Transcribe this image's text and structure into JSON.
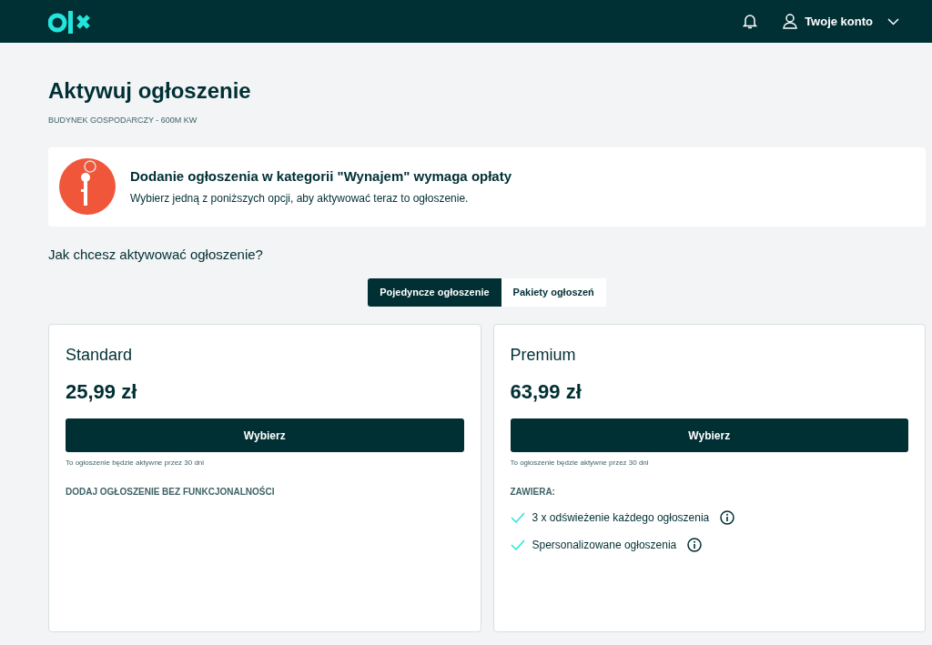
{
  "header": {
    "account_label": "Twoje konto"
  },
  "page": {
    "title": "Aktywuj ogłoszenie",
    "subtitle": "BUDYNEK GOSPODARCZY - 600M KW"
  },
  "notice": {
    "title": "Dodanie ogłoszenia w kategorii \"Wynajem\" wymaga opłaty",
    "text": "Wybierz jedną z poniższych opcji, aby aktywować teraz to ogłoszenie."
  },
  "question": "Jak chcesz aktywować ogłoszenie?",
  "tabs": [
    {
      "label": "Pojedyncze ogłoszenie",
      "selected": true
    },
    {
      "label": "Pakiety ogłoszeń",
      "selected": false
    }
  ],
  "plans": [
    {
      "name": "Standard",
      "price": "25,99 zł",
      "button": "Wybierz",
      "note": "To ogłoszenie będzie aktywne przez 30 dni",
      "section": "DODAJ OGŁOSZENIE BEZ FUNKCJONALNOŚCI"
    },
    {
      "name": "Premium",
      "price": "63,99 zł",
      "button": "Wybierz",
      "note": "To ogłoszenie będzie aktywne przez 30 dni",
      "section": "ZAWIERA:",
      "features": [
        "3 x odświeżenie każdego ogłoszenia",
        "Spersonalizowane ogłoszenia"
      ]
    }
  ]
}
